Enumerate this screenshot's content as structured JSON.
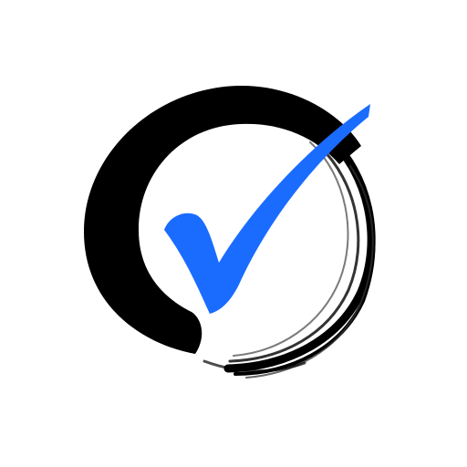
{
  "logo": {
    "icon": "enso-circle-checkmark-icon",
    "colors": {
      "background": "#ffffff",
      "circle": "#000000",
      "check": "#1a6cff"
    }
  }
}
